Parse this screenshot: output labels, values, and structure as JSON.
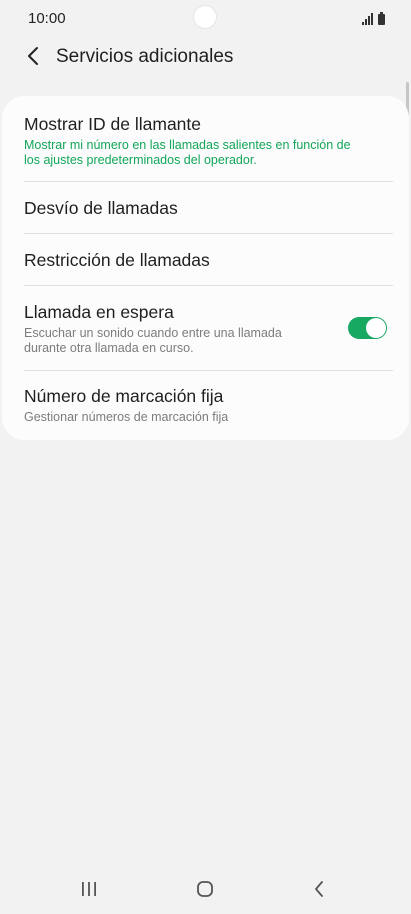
{
  "status_bar": {
    "time": "10:00"
  },
  "header": {
    "title": "Servicios adicionales",
    "back_icon": "chevron-left-icon"
  },
  "settings": {
    "items": [
      {
        "title": "Mostrar ID de llamante",
        "description": "Mostrar mi número en las llamadas salientes en función de los ajustes predeterminados del operador."
      },
      {
        "title": "Desvío de llamadas"
      },
      {
        "title": "Restricción de llamadas"
      },
      {
        "title": "Llamada en espera",
        "description": "Escuchar un sonido cuando entre una llamada durante otra llamada en curso.",
        "toggle_on": true
      },
      {
        "title": "Número de marcación fija",
        "description": "Gestionar números de marcación fija"
      }
    ]
  },
  "colors": {
    "accent": "#12a65a",
    "toggle_on": "#17a862",
    "background": "#f2f2f2",
    "card": "#fcfcfc"
  },
  "nav_bar": {
    "icons": [
      "recent-apps-icon",
      "home-icon",
      "back-icon"
    ]
  }
}
